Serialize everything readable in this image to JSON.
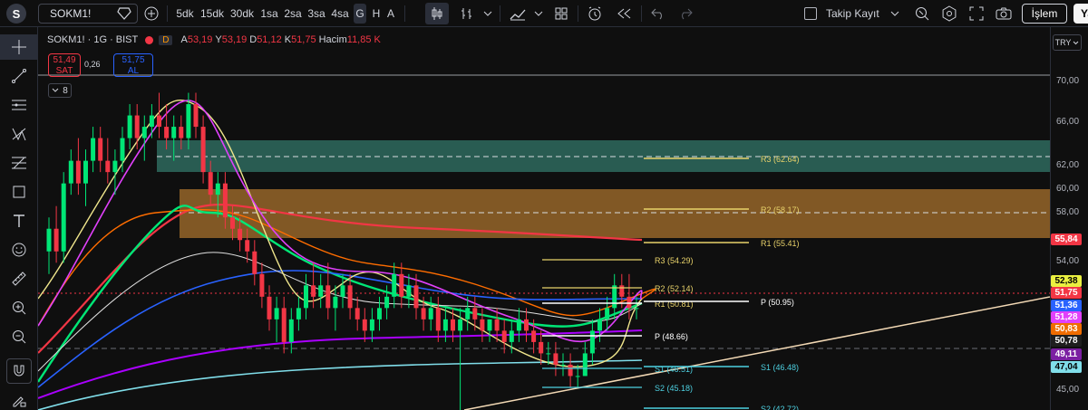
{
  "toolbar": {
    "logo_letter": "S",
    "symbol": "SOKM1!",
    "timeframes": [
      "5dk",
      "15dk",
      "30dk",
      "1sa",
      "2sa",
      "3sa",
      "4sa",
      "G",
      "H",
      "A"
    ],
    "active_timeframe": "G",
    "follow_label": "Takip Kayıt",
    "trade_label": "İşlem",
    "ya_label": "Ya"
  },
  "legend": {
    "symbol_line": "SOKM1! · 1G · BIST",
    "d_badge": "D",
    "open_key": "A",
    "open_val": "53,19",
    "high_key": "Y",
    "high_val": "53,19",
    "low_key": "D",
    "low_val": "51,12",
    "close_key": "K",
    "close_val": "51,75",
    "volume_key": "Hacim",
    "volume_val": "11,85 K"
  },
  "quote": {
    "sell_price": "51,49",
    "sell_label": "SAT",
    "spread": "0,26",
    "buy_price": "51,75",
    "buy_label": "AL",
    "indicator_count": "8"
  },
  "currency": "TRY",
  "price_axis": {
    "ticks": [
      "70,00",
      "66,00",
      "62,00",
      "60,00",
      "58,00",
      "54,00",
      "45,00"
    ],
    "tags": [
      {
        "value": "55,84",
        "bg": "#f23645",
        "fg": "#ffffff"
      },
      {
        "value": "52,38",
        "bg": "#eaf040",
        "fg": "#000000"
      },
      {
        "value": "51,75",
        "bg": "#f23645",
        "fg": "#ffffff"
      },
      {
        "value": "51,36",
        "bg": "#2962ff",
        "fg": "#ffffff"
      },
      {
        "value": "51,28",
        "bg": "#e040fb",
        "fg": "#ffffff"
      },
      {
        "value": "50,83",
        "bg": "#ef6c00",
        "fg": "#ffffff"
      },
      {
        "value": "50,78",
        "bg": "#1e1e1e",
        "fg": "#ffffff"
      },
      {
        "value": "49,11",
        "bg": "#7b1fa2",
        "fg": "#ffffff"
      },
      {
        "value": "47,04",
        "bg": "#80deea",
        "fg": "#000000"
      }
    ]
  },
  "pivots": {
    "weekly": [
      {
        "label": "R3 (54.29)",
        "color": "#e8d26a"
      },
      {
        "label": "R2 (52.14)",
        "color": "#e8d26a"
      },
      {
        "label": "R1 (50.81)",
        "color": "#e8d26a"
      },
      {
        "label": "P (48.66)",
        "color": "#ffffff"
      },
      {
        "label": "S1 (46.51)",
        "color": "#4dd0e1"
      },
      {
        "label": "S2 (45.18)",
        "color": "#4dd0e1"
      }
    ],
    "monthly": [
      {
        "label": "R3 (62.64)",
        "color": "#e8d26a"
      },
      {
        "label": "R2 (58.17)",
        "color": "#e8d26a"
      },
      {
        "label": "R1 (55.41)",
        "color": "#e8d26a"
      },
      {
        "label": "P (50.95)",
        "color": "#ffffff"
      },
      {
        "label": "S1 (46.48)",
        "color": "#4dd0e1"
      },
      {
        "label": "S2 (42.72)",
        "color": "#4dd0e1"
      }
    ]
  },
  "chart_data": {
    "type": "candlestick",
    "ylim": [
      43,
      72
    ],
    "ohlc": [
      [
        57,
        60,
        55,
        59
      ],
      [
        59,
        61,
        56,
        57
      ],
      [
        57,
        64,
        56,
        63
      ],
      [
        63,
        66,
        62,
        65
      ],
      [
        65,
        67,
        62,
        63
      ],
      [
        63,
        66,
        61,
        65
      ],
      [
        65,
        68,
        64,
        67
      ],
      [
        67,
        68,
        64,
        65
      ],
      [
        65,
        67,
        63,
        64
      ],
      [
        64,
        66,
        62,
        65
      ],
      [
        65,
        68,
        64,
        67
      ],
      [
        67,
        70,
        66,
        69
      ],
      [
        69,
        70,
        66,
        67
      ],
      [
        67,
        69,
        65,
        68
      ],
      [
        68,
        70,
        67,
        69
      ],
      [
        69,
        71,
        67,
        68
      ],
      [
        68,
        70,
        66,
        67
      ],
      [
        67,
        69,
        65,
        68
      ],
      [
        68,
        69,
        66,
        67
      ],
      [
        67,
        71,
        66,
        70
      ],
      [
        70,
        71,
        67,
        68
      ],
      [
        68,
        69,
        63,
        64
      ],
      [
        64,
        65,
        61,
        62
      ],
      [
        62,
        64,
        60,
        63
      ],
      [
        63,
        64,
        59,
        60
      ],
      [
        60,
        61,
        58,
        59
      ],
      [
        59,
        60,
        57,
        58
      ],
      [
        58,
        59,
        56,
        57
      ],
      [
        57,
        58,
        54,
        55
      ],
      [
        55,
        56,
        52,
        53
      ],
      [
        53,
        54,
        50,
        51
      ],
      [
        51,
        53,
        49,
        52
      ],
      [
        52,
        53,
        48,
        49
      ],
      [
        49,
        52,
        48,
        51
      ],
      [
        51,
        53,
        50,
        52
      ],
      [
        52,
        55,
        51,
        54
      ],
      [
        54,
        56,
        52,
        53
      ],
      [
        53,
        55,
        52,
        54
      ],
      [
        54,
        56,
        51,
        52
      ],
      [
        52,
        54,
        50,
        53
      ],
      [
        53,
        55,
        52,
        54
      ],
      [
        54,
        55,
        51,
        52
      ],
      [
        52,
        53,
        50,
        51
      ],
      [
        51,
        52,
        49,
        50
      ],
      [
        50,
        52,
        49,
        51
      ],
      [
        51,
        53,
        50,
        52
      ],
      [
        52,
        54,
        51,
        53
      ],
      [
        53,
        56,
        52,
        55
      ],
      [
        55,
        56,
        52,
        53
      ],
      [
        53,
        55,
        52,
        54
      ],
      [
        54,
        55,
        51,
        52
      ],
      [
        52,
        53,
        50,
        51
      ],
      [
        51,
        53,
        50,
        52
      ],
      [
        52,
        53,
        49,
        50
      ],
      [
        50,
        52,
        49,
        51
      ],
      [
        51,
        52,
        49,
        50
      ],
      [
        50,
        52,
        43,
        51
      ],
      [
        51,
        53,
        50,
        52
      ],
      [
        52,
        53,
        50,
        51
      ],
      [
        51,
        52,
        49,
        50
      ],
      [
        50,
        51,
        49,
        51
      ],
      [
        51,
        52,
        49,
        50
      ],
      [
        50,
        51,
        48,
        49
      ],
      [
        49,
        51,
        48,
        50
      ],
      [
        50,
        52,
        49,
        51
      ],
      [
        51,
        52,
        49,
        50
      ],
      [
        50,
        51,
        48,
        49
      ],
      [
        49,
        50,
        47,
        48
      ],
      [
        48,
        49,
        47,
        48
      ],
      [
        48,
        49,
        46,
        47
      ],
      [
        47,
        48,
        46,
        47
      ],
      [
        47,
        48,
        45,
        46
      ],
      [
        46,
        47,
        45,
        46
      ],
      [
        46,
        49,
        46,
        48
      ],
      [
        48,
        51,
        47,
        50
      ],
      [
        50,
        52,
        49,
        51
      ],
      [
        51,
        53,
        50,
        52
      ],
      [
        52,
        55,
        51,
        54
      ],
      [
        54,
        55,
        52,
        53
      ],
      [
        53,
        55,
        51,
        52
      ],
      [
        52,
        53,
        51,
        52
      ]
    ]
  }
}
